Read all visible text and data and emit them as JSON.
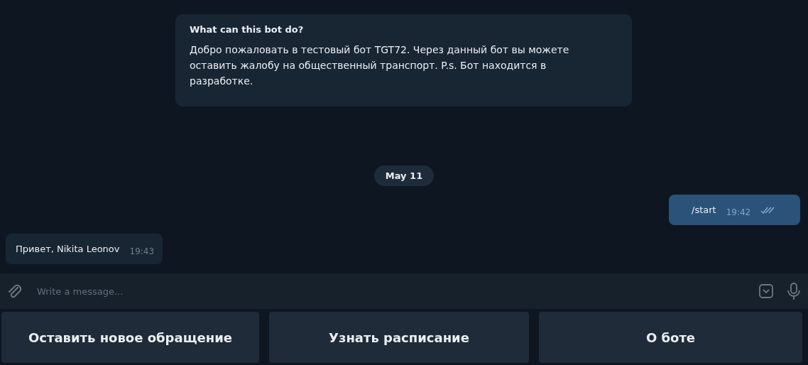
{
  "bot_info": {
    "title": "What can this bot do?",
    "text": "Добро пожаловать в тестовый бот TGT72. Через данный бот вы можете оставить жалобу на общественный транспорт. P.s. Бот находится в разработке."
  },
  "date_separator": "May 11",
  "messages": [
    {
      "kind": "outgoing",
      "text": "/start",
      "time": "19:42",
      "read": true
    },
    {
      "kind": "incoming",
      "text": "Привет, Nikita Leonov",
      "time": "19:43"
    }
  ],
  "composer": {
    "placeholder": "Write a message..."
  },
  "keyboard": [
    "Оставить новое обращение",
    "Узнать расписание",
    "О боте"
  ]
}
